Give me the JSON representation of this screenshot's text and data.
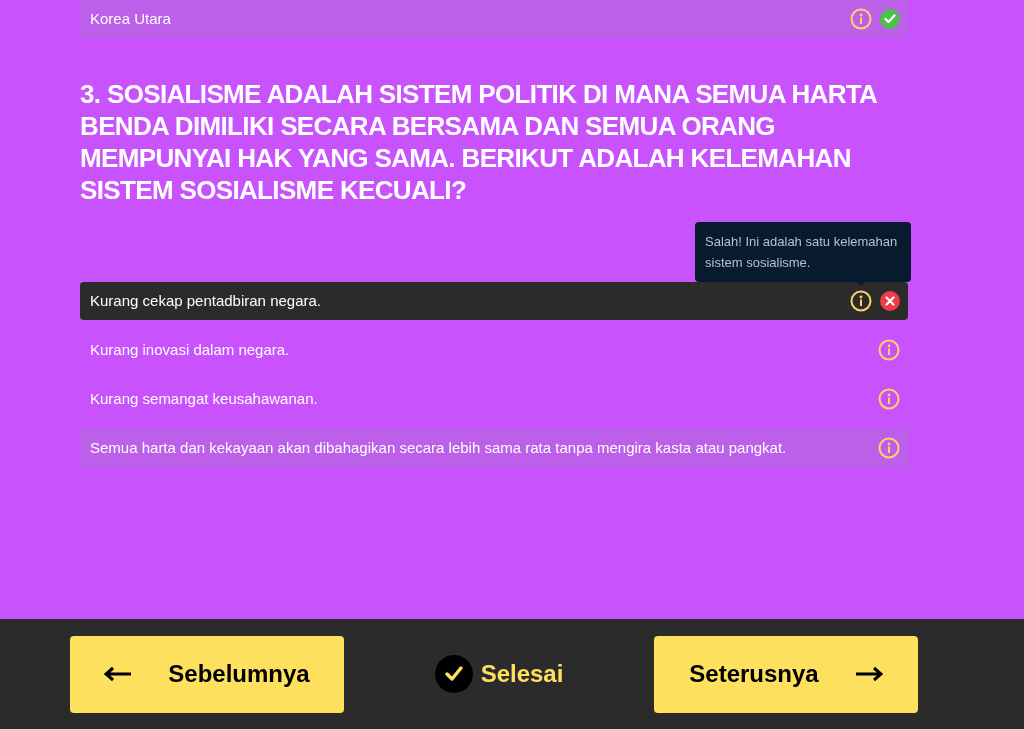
{
  "previous_answer": {
    "label": "Korea Utara",
    "selected": true,
    "correct": true
  },
  "question": {
    "text": "3. SOSIALISME ADALAH SISTEM POLITIK DI MANA SEMUA HARTA BENDA DIMILIKI SECARA BERSAMA DAN SEMUA ORANG MEMPUNYAI HAK YANG SAMA. BERIKUT ADALAH KELEMAHAN SISTEM SOSIALISME KECUALI?",
    "options": [
      {
        "label": "Kurang cekap pentadbiran negara.",
        "selected": true,
        "correct": false,
        "tooltip": "Salah! Ini adalah satu kelemahan sistem sosialisme."
      },
      {
        "label": "Kurang inovasi dalam negara.",
        "selected": false,
        "correct": false
      },
      {
        "label": "Kurang semangat keusahawanan.",
        "selected": false,
        "correct": false
      },
      {
        "label": "Semua harta dan kekayaan akan dibahagikan secara lebih sama rata tanpa mengira kasta atau pangkat.",
        "selected": false,
        "correct": true
      }
    ]
  },
  "footer": {
    "previous": "Sebelumnya",
    "finish": "Selesai",
    "next": "Seterusnya"
  }
}
